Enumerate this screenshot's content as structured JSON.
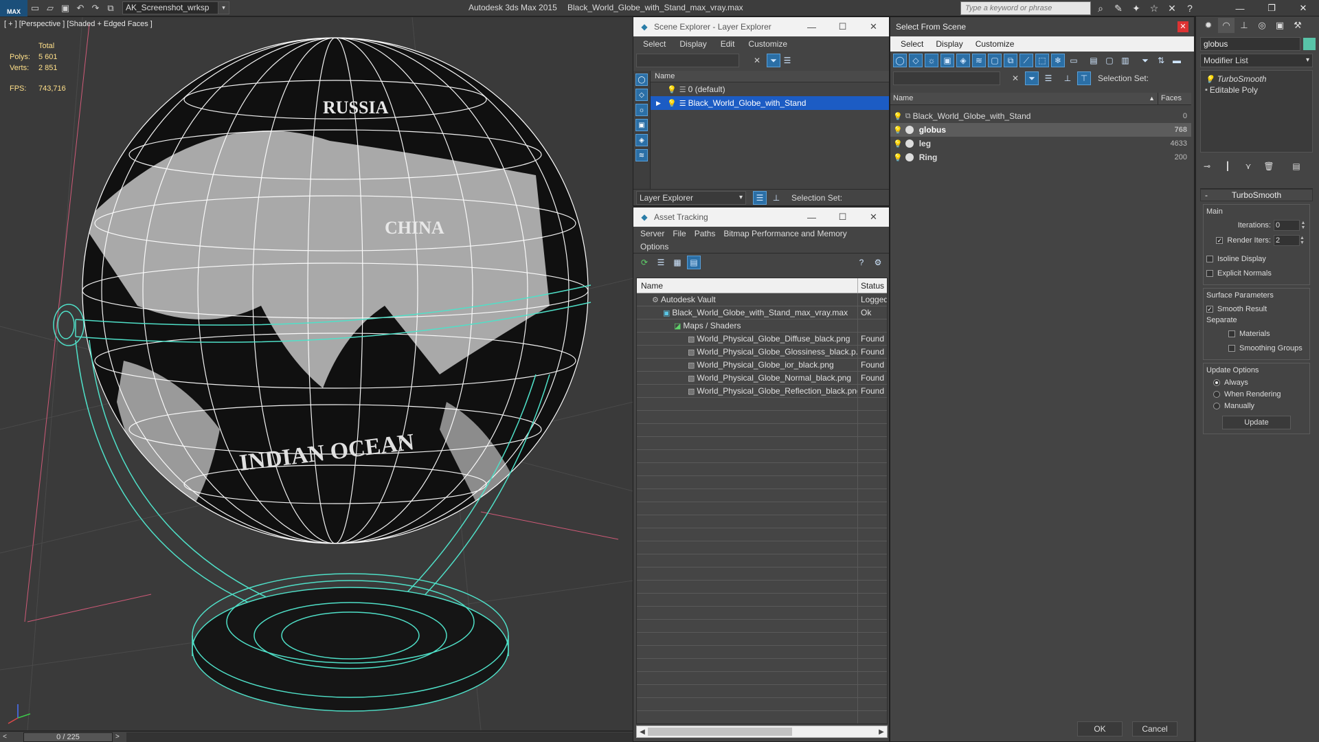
{
  "app": {
    "title": "Autodesk 3ds Max  2015",
    "file": "Black_World_Globe_with_Stand_max_vray.max",
    "workspace": "AK_Screenshot_wrksp",
    "logo_text": "MAX",
    "search_placeholder": "Type a keyword or phrase"
  },
  "viewport": {
    "label": "[ + ] [Perspective ] [Shaded + Edged Faces ]",
    "stats_header": "Total",
    "polys_label": "Polys:",
    "polys_value": "5 601",
    "verts_label": "Verts:",
    "verts_value": "2 851",
    "fps_label": "FPS:",
    "fps_value": "743,716",
    "map_labels": [
      "RUSSIA",
      "CHINA",
      "INDIAN OCEAN"
    ]
  },
  "timeline": {
    "frame": "0 / 225"
  },
  "scene_explorer": {
    "title": "Scene Explorer - Layer Explorer",
    "menu": [
      "Select",
      "Display",
      "Edit",
      "Customize"
    ],
    "column": "Name",
    "rows": [
      {
        "label": "0 (default)",
        "selected": false
      },
      {
        "label": "Black_World_Globe_with_Stand",
        "selected": true
      }
    ],
    "bottom_dropdown": "Layer Explorer",
    "selection_set_label": "Selection Set:"
  },
  "asset_tracking": {
    "title": "Asset Tracking",
    "menu": [
      "Server",
      "File",
      "Paths",
      "Bitmap Performance and Memory"
    ],
    "menu2": [
      "Options"
    ],
    "columns": [
      "Name",
      "Status"
    ],
    "rows": [
      {
        "name": "Autodesk Vault",
        "status": "Logged",
        "indent": 1
      },
      {
        "name": "Black_World_Globe_with_Stand_max_vray.max",
        "status": "Ok",
        "indent": 2
      },
      {
        "name": "Maps / Shaders",
        "status": "",
        "indent": 3
      },
      {
        "name": "World_Physical_Globe_Diffuse_black.png",
        "status": "Found",
        "indent": 4
      },
      {
        "name": "World_Physical_Globe_Glossiness_black.p...",
        "status": "Found",
        "indent": 4
      },
      {
        "name": "World_Physical_Globe_ior_black.png",
        "status": "Found",
        "indent": 4
      },
      {
        "name": "World_Physical_Globe_Normal_black.png",
        "status": "Found",
        "indent": 4
      },
      {
        "name": "World_Physical_Globe_Reflection_black.png",
        "status": "Found",
        "indent": 4
      }
    ]
  },
  "select_from_scene": {
    "title": "Select From Scene",
    "menu": [
      "Select",
      "Display",
      "Customize"
    ],
    "selection_set_label": "Selection Set:",
    "columns": [
      "Name",
      "Faces"
    ],
    "rows": [
      {
        "name": "Black_World_Globe_with_Stand",
        "faces": "0"
      },
      {
        "name": "globus",
        "faces": "768"
      },
      {
        "name": "leg",
        "faces": "4633"
      },
      {
        "name": "Ring",
        "faces": "200"
      }
    ],
    "ok": "OK",
    "cancel": "Cancel"
  },
  "command_panel": {
    "object_name": "globus",
    "object_color": "#58c4a8",
    "modifier_list": "Modifier List",
    "stack": [
      "TurboSmooth",
      "Editable Poly"
    ],
    "rollout_title": "TurboSmooth",
    "main_label": "Main",
    "iterations_label": "Iterations:",
    "iterations_value": "0",
    "render_iters_label": "Render Iters:",
    "render_iters_value": "2",
    "isoline": "Isoline Display",
    "explicit": "Explicit Normals",
    "surface_label": "Surface Parameters",
    "smooth_result": "Smooth Result",
    "separate_label": "Separate",
    "materials": "Materials",
    "smoothing_groups": "Smoothing Groups",
    "update_label": "Update Options",
    "always": "Always",
    "when_rendering": "When Rendering",
    "manually": "Manually",
    "update_button": "Update"
  }
}
